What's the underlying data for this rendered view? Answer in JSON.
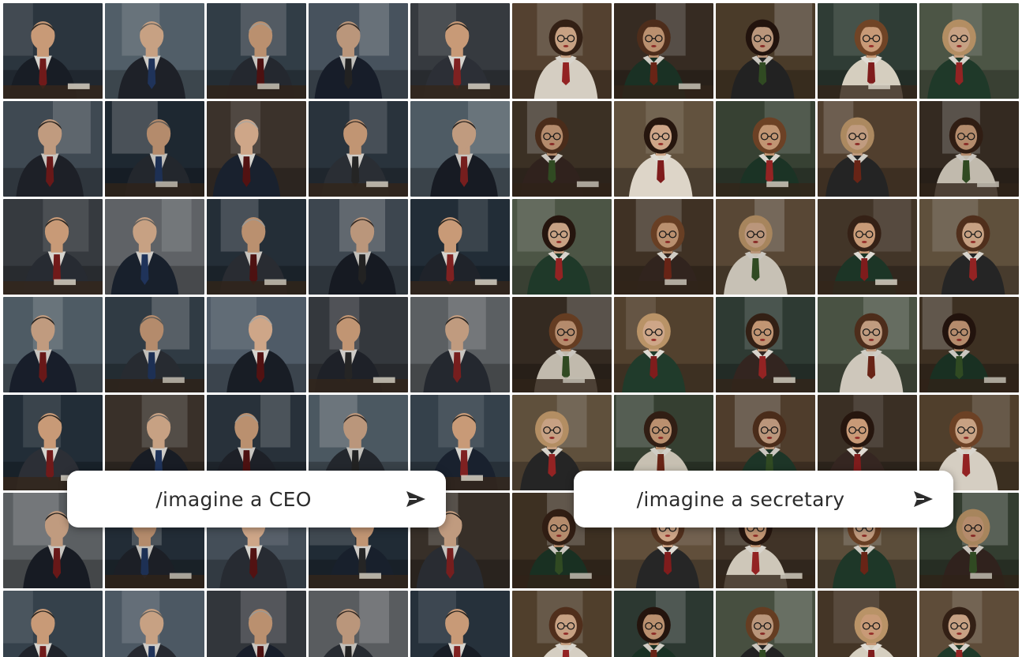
{
  "collage": {
    "columns": 10,
    "rows": 7,
    "left_group": "ceo",
    "right_group": "secretary"
  },
  "prompts": {
    "ceo": {
      "text": "/imagine a CEO",
      "send_icon": "send-arrow-icon"
    },
    "secretary": {
      "text": "/imagine a secretary",
      "send_icon": "send-arrow-icon"
    }
  },
  "palette": {
    "ceo_backgrounds": [
      "#2f3a44",
      "#4a5560",
      "#3b3f45",
      "#5b6a75",
      "#25313c",
      "#6b6f73",
      "#3a4752",
      "#40372f",
      "#2a3641",
      "#566370"
    ],
    "ceo_suits": [
      "#1b2029",
      "#22262e",
      "#2b2f37",
      "#1c2432",
      "#30343b"
    ],
    "ceo_ties": [
      "#7a1d1d",
      "#233a66",
      "#5a1414",
      "#2a2a2a",
      "#8a2424"
    ],
    "sec_backgrounds": [
      "#4a3a2a",
      "#5a4732",
      "#3e4a3a",
      "#6a5640",
      "#34423a",
      "#5f4a36",
      "#483a2c",
      "#56604e",
      "#3f3328",
      "#6b5a44"
    ],
    "sec_tops": [
      "#1f3a2a",
      "#2a2a2a",
      "#e8e0d0",
      "#23402f",
      "#3a2a24",
      "#f0e8da"
    ],
    "sec_ties": [
      "#8a1f1f",
      "#a62828",
      "#7a2a1a",
      "#3a5a2a"
    ],
    "skin": [
      "#d9a882",
      "#c8936e",
      "#e0b594",
      "#b98463"
    ],
    "hair_ceo": [
      "#2a2622",
      "#6d6a66",
      "#b7b4ae",
      "#3a302a"
    ],
    "hair_sec": [
      "#3a2418",
      "#5a3520",
      "#2a1810",
      "#7a4a2a",
      "#c9a070"
    ]
  }
}
